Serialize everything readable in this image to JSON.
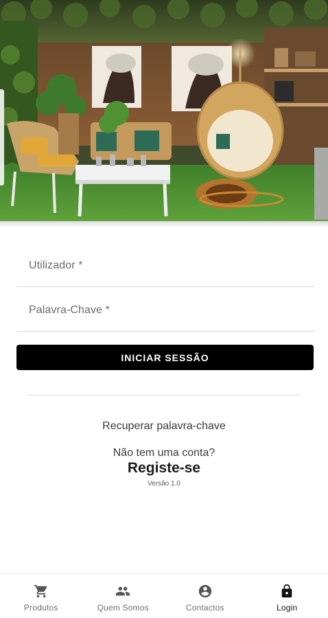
{
  "form": {
    "username_label": "Utilizador *",
    "password_label": "Palavra-Chave *",
    "login_button": "INICIAR SESSÃO"
  },
  "links": {
    "recover_password": "Recuperar palavra-chave",
    "no_account": "Não tem uma conta?",
    "register": "Registe-se",
    "version": "Versão 1.0"
  },
  "bottom_nav": {
    "items": [
      {
        "label": "Produtos",
        "icon": "shopping-cart-icon"
      },
      {
        "label": "Quem Somos",
        "icon": "people-icon"
      },
      {
        "label": "Contactos",
        "icon": "account-circle-icon"
      },
      {
        "label": "Login",
        "icon": "lock-icon"
      }
    ],
    "active": "Login"
  },
  "colors": {
    "primary_button": "#000000",
    "divider": "#d9d9d9",
    "label_gray": "#6b6b6b"
  }
}
